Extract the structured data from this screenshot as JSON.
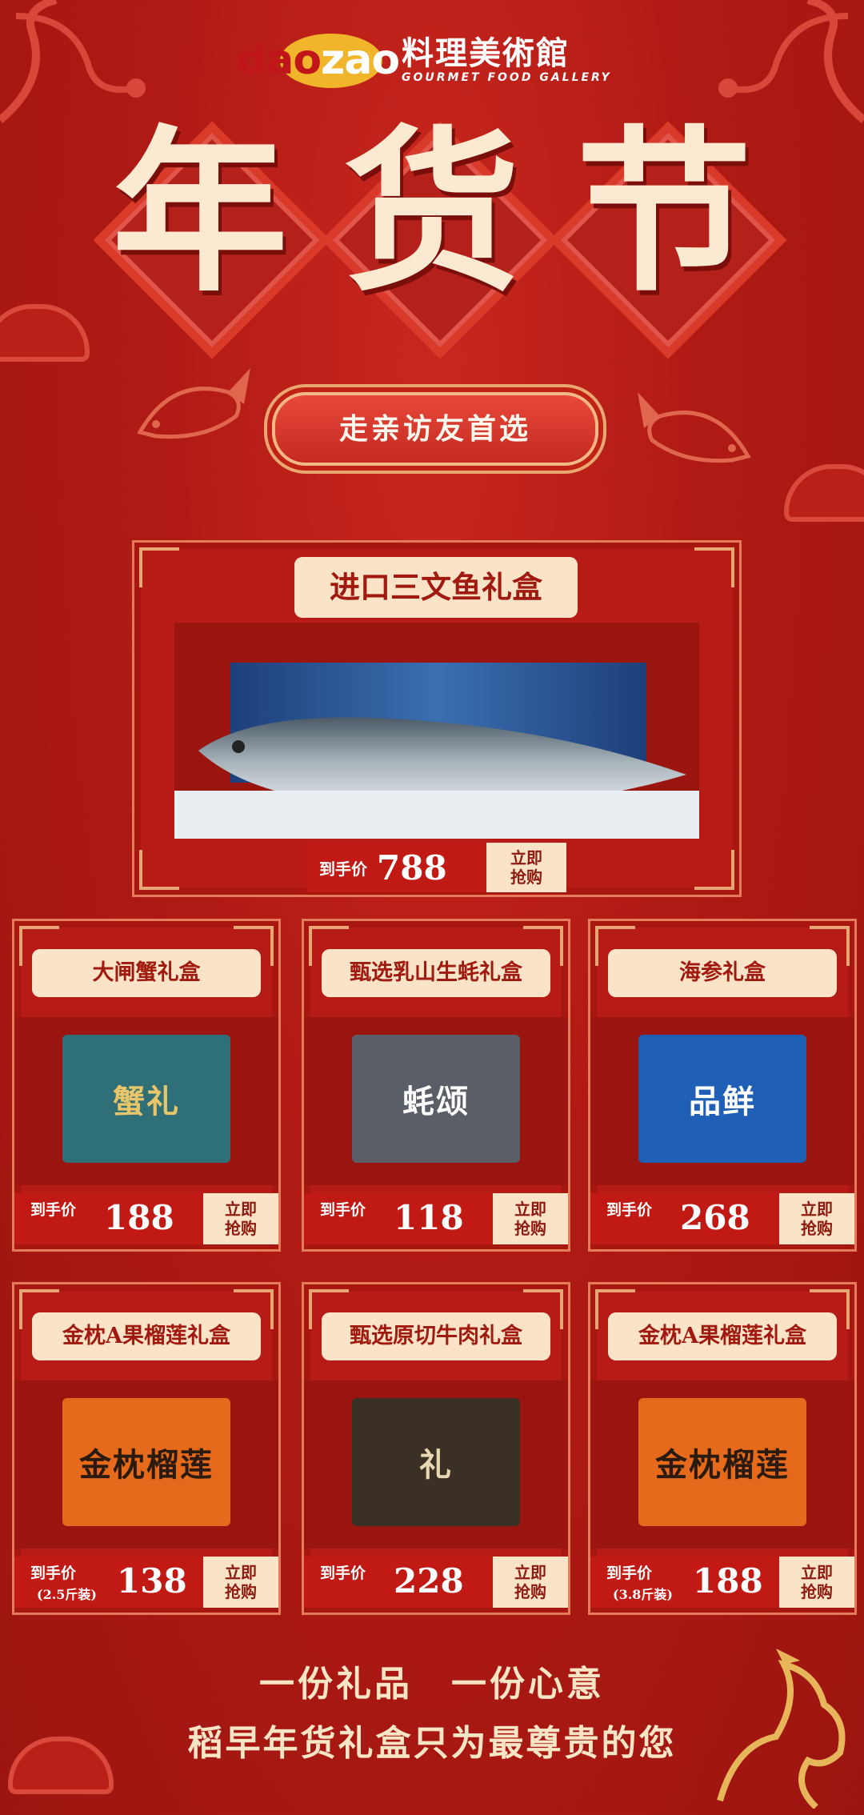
{
  "brand": {
    "logo_latin_prefix": "dao",
    "logo_latin_suffix": "zao",
    "logo_cn": "料理美術館",
    "logo_en": "GOURMET FOOD GALLERY"
  },
  "hero": {
    "title": "年货节",
    "banner": "走亲访友首选"
  },
  "colors": {
    "background": "#b01a14",
    "cream": "#fbe3c7",
    "accent_gold": "#f0b52a",
    "price_red": "#c11a15"
  },
  "featured": {
    "title": "进口三文鱼礼盒",
    "price_label": "到手价",
    "price": "788",
    "buy_label_1": "立即",
    "buy_label_2": "抢购"
  },
  "products": [
    {
      "title": "大闸蟹礼盒",
      "price_label": "到手价",
      "price": "188",
      "buy_label_1": "立即",
      "buy_label_2": "抢购",
      "box_text": "蟹礼"
    },
    {
      "title": "甄选乳山生蚝礼盒",
      "price_label": "到手价",
      "price": "118",
      "buy_label_1": "立即",
      "buy_label_2": "抢购",
      "box_text": "蚝颂"
    },
    {
      "title": "海参礼盒",
      "price_label": "到手价",
      "price": "268",
      "buy_label_1": "立即",
      "buy_label_2": "抢购",
      "box_text": "品鲜"
    },
    {
      "title": "金枕A果榴莲礼盒",
      "price_label": "到手价",
      "price_note": "(2.5斤装)",
      "price": "138",
      "buy_label_1": "立即",
      "buy_label_2": "抢购",
      "box_text": "金枕榴莲"
    },
    {
      "title": "甄选原切牛肉礼盒",
      "price_label": "到手价",
      "price": "228",
      "buy_label_1": "立即",
      "buy_label_2": "抢购",
      "box_text": "礼"
    },
    {
      "title": "金枕A果榴莲礼盒",
      "price_label": "到手价",
      "price_note": "(3.8斤装)",
      "price": "188",
      "buy_label_1": "立即",
      "buy_label_2": "抢购",
      "box_text": "金枕榴莲"
    }
  ],
  "footer": {
    "line1": "一份礼品　一份心意",
    "line2": "稻早年货礼盒只为最尊贵的您"
  }
}
